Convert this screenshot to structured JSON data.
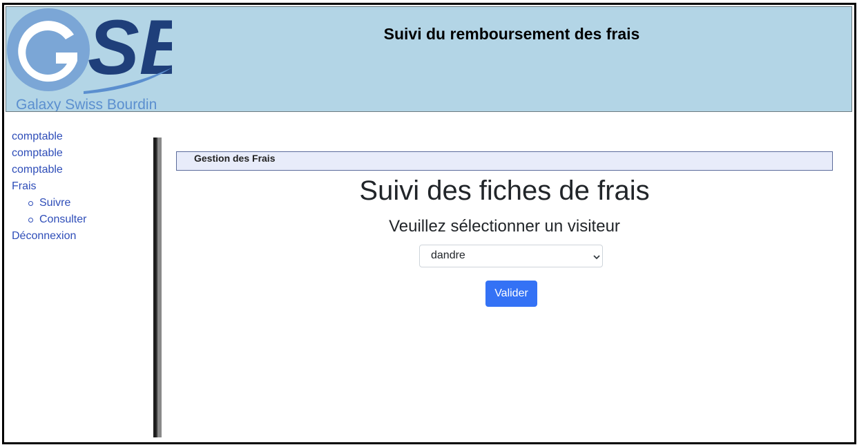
{
  "header": {
    "logo_letters": "GSB",
    "logo_caption": "Galaxy Swiss Bourdin",
    "title": "Suivi du remboursement des frais"
  },
  "sidebar": {
    "items": [
      {
        "label": "comptable"
      },
      {
        "label": "comptable"
      },
      {
        "label": "comptable"
      },
      {
        "label": "Frais",
        "children": [
          {
            "label": "Suivre"
          },
          {
            "label": "Consulter"
          }
        ]
      },
      {
        "label": "Déconnexion"
      }
    ]
  },
  "main": {
    "section_label": "Gestion des Frais",
    "page_title": "Suivi des fiches de frais",
    "subtitle": "Veuillez sélectionner un visiteur",
    "visitor_select": {
      "selected": "dandre"
    },
    "submit_label": "Valider"
  },
  "colors": {
    "header_bg": "#b3d5e6",
    "link": "#2e4db8",
    "button": "#3472f5",
    "section_bar_bg": "#e8ecfa"
  }
}
